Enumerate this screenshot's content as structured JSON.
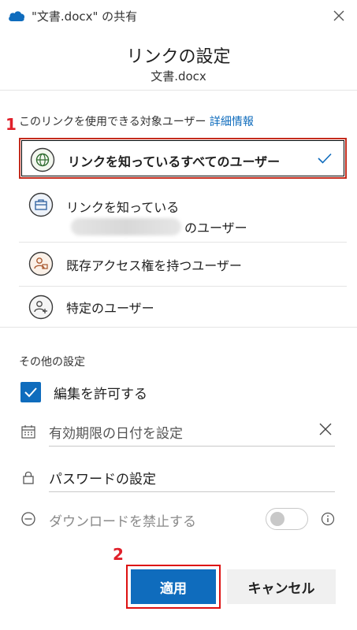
{
  "window": {
    "title": "\"文書.docx\" の共有",
    "cloud_icon": "onedrive-cloud-icon",
    "close_icon": "close-icon"
  },
  "header": {
    "title": "リンクの設定",
    "subtitle": "文書.docx"
  },
  "audience": {
    "label": "このリンクを使用できる対象ユーザー",
    "details_link": "詳細情報",
    "options": [
      {
        "label": "リンクを知っているすべてのユーザー",
        "icon": "globe-icon",
        "selected": true
      },
      {
        "label_line1": "リンクを知っている",
        "label_line2": "のユーザー",
        "icon": "organization-icon",
        "selected": false
      },
      {
        "label": "既存アクセス権を持つユーザー",
        "icon": "existing-access-icon",
        "selected": false
      },
      {
        "label": "特定のユーザー",
        "icon": "specific-people-icon",
        "selected": false
      }
    ]
  },
  "other_settings": {
    "label": "その他の設定",
    "allow_edit": {
      "label": "編集を許可する",
      "checked": true
    },
    "expiration": {
      "placeholder": "有効期限の日付を設定"
    },
    "password": {
      "placeholder": "パスワードの設定"
    },
    "block_download": {
      "label": "ダウンロードを禁止する",
      "enabled": false,
      "on": false
    }
  },
  "annotations": {
    "step1": "1",
    "step2": "2"
  },
  "buttons": {
    "apply": "適用",
    "cancel": "キャンセル"
  },
  "colors": {
    "accent": "#0f6cbd",
    "annotation_red": "#e0202a"
  }
}
